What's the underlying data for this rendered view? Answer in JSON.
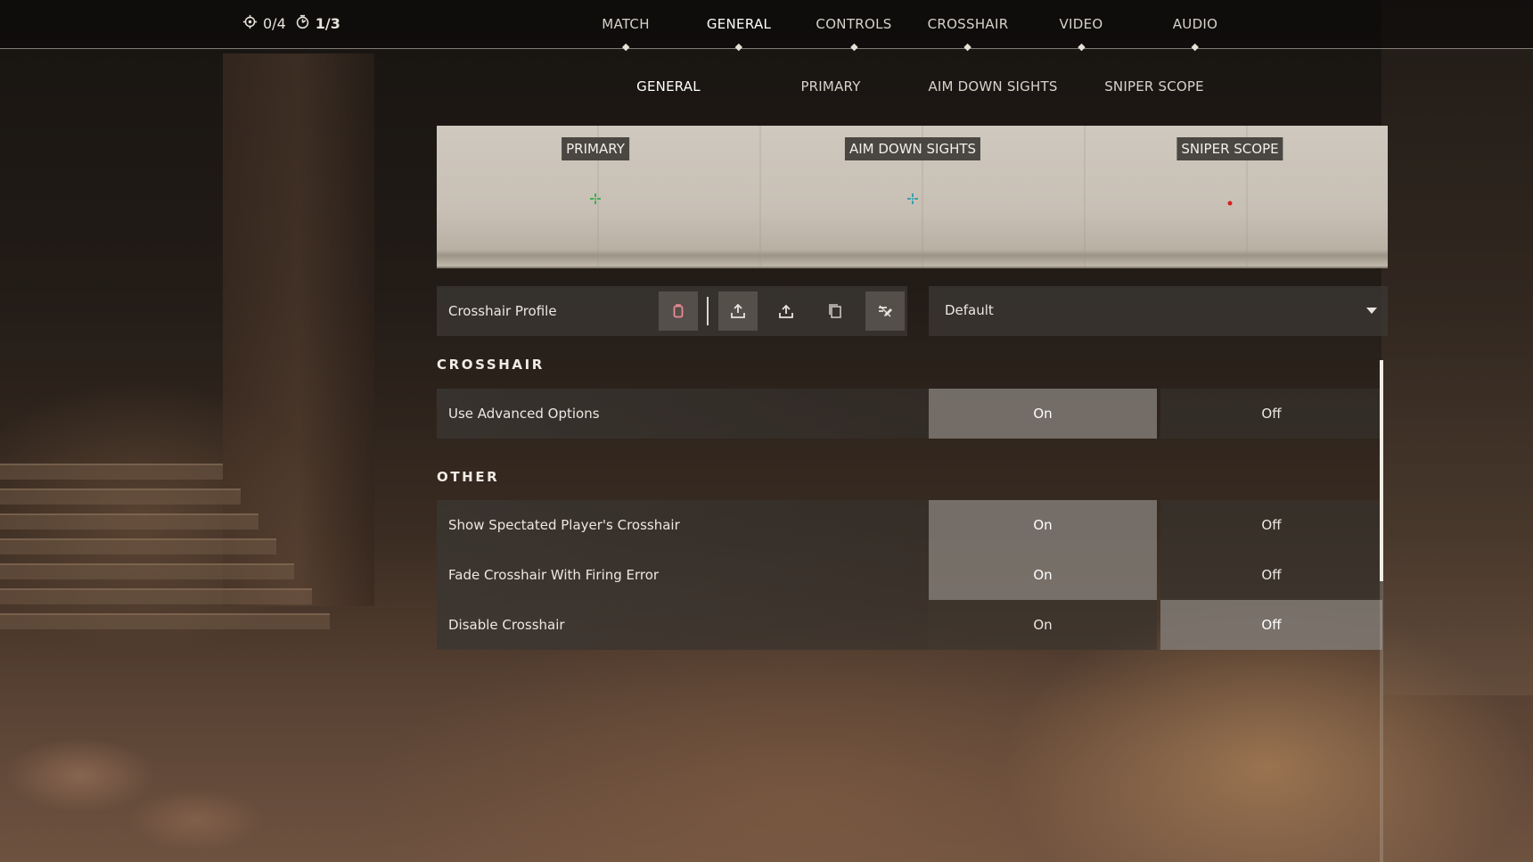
{
  "counters": {
    "first": "0/4",
    "second": "1/3"
  },
  "main_tabs": [
    {
      "label": "MATCH"
    },
    {
      "label": "GENERAL"
    },
    {
      "label": "CONTROLS"
    },
    {
      "label": "CROSSHAIR"
    },
    {
      "label": "VIDEO"
    },
    {
      "label": "AUDIO"
    }
  ],
  "main_tabs_active": "GENERAL",
  "sub_tabs": [
    {
      "label": "GENERAL"
    },
    {
      "label": "PRIMARY"
    },
    {
      "label": "AIM DOWN SIGHTS"
    },
    {
      "label": "SNIPER SCOPE"
    }
  ],
  "sub_tabs_active": "GENERAL",
  "preview": {
    "labels": [
      "PRIMARY",
      "AIM DOWN SIGHTS",
      "SNIPER SCOPE"
    ],
    "crosshair_colors": [
      "#3fae58",
      "#3aa0b0",
      "#d62020"
    ]
  },
  "profile": {
    "label": "Crosshair Profile",
    "icons": [
      "delete-icon",
      "import-icon",
      "export-icon",
      "copy-icon",
      "rename-icon"
    ],
    "dropdown_value": "Default"
  },
  "sections": {
    "crosshair_title": "CROSSHAIR",
    "other_title": "OTHER"
  },
  "settings": [
    {
      "label": "Use Advanced Options",
      "on": "On",
      "off": "Off",
      "selected": "on"
    },
    {
      "label": "Show Spectated Player's Crosshair",
      "on": "On",
      "off": "Off",
      "selected": "on"
    },
    {
      "label": "Fade Crosshair With Firing Error",
      "on": "On",
      "off": "Off",
      "selected": "on"
    },
    {
      "label": "Disable Crosshair",
      "on": "On",
      "off": "Off",
      "selected": "off"
    }
  ]
}
